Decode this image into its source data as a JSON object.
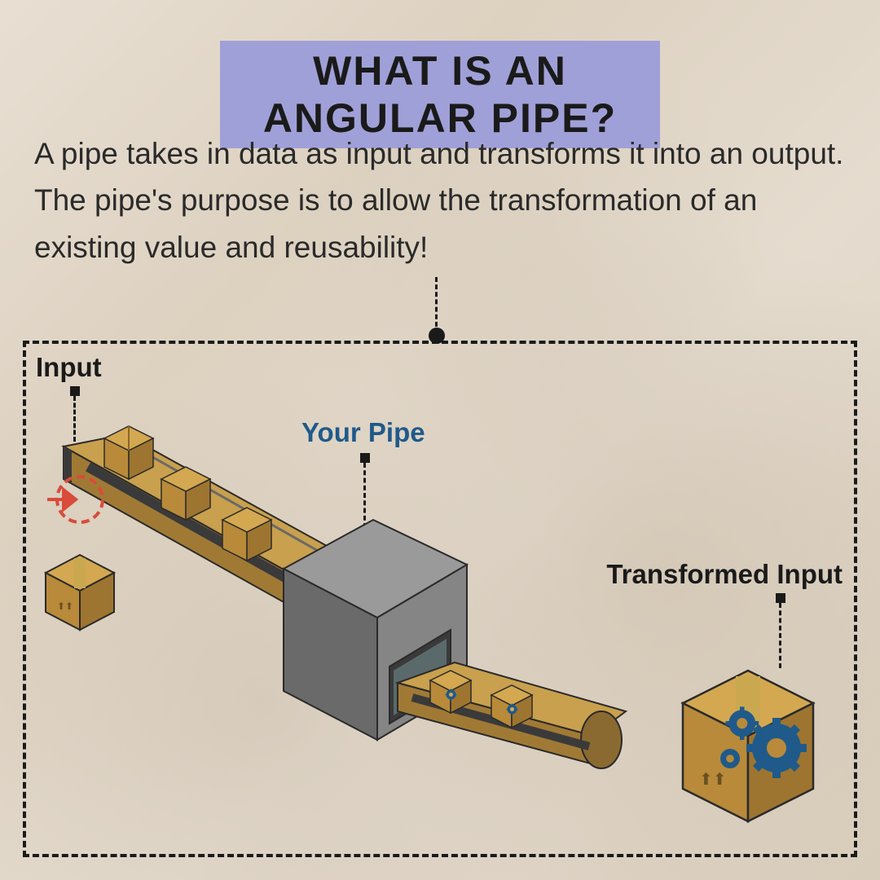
{
  "title": "WHAT IS AN ANGULAR PIPE?",
  "description": "A pipe takes in data as input and transforms it into an output. The pipe's purpose is to allow the transformation of an existing value and reusability!",
  "labels": {
    "input": "Input",
    "pipe": "Your Pipe",
    "output": "Transformed Input"
  },
  "colors": {
    "title_bg": "#a0a0d8",
    "pipe_label": "#1f5a8a",
    "input_icon": "#d94b3a",
    "gear": "#1f5a8a",
    "box": "#b88a3a",
    "machine": "#7a7a7a"
  }
}
